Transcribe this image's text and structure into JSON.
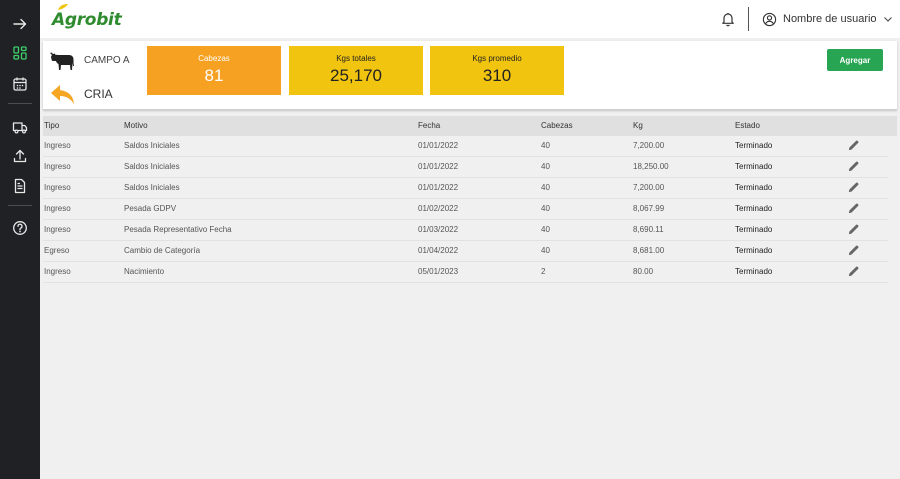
{
  "app": {
    "logo_text": "Agrobit",
    "user_name": "Nombre de usuario",
    "brand_color": "#2e8b2e"
  },
  "sidebar": {
    "items": [
      {
        "icon": "arrow-right-icon"
      },
      {
        "icon": "dashboard-grid-icon",
        "active": true
      },
      {
        "icon": "calendar-icon"
      },
      {
        "icon": "truck-icon"
      },
      {
        "icon": "upload-icon"
      },
      {
        "icon": "document-icon"
      },
      {
        "icon": "help-icon"
      }
    ]
  },
  "summary": {
    "campo": "CAMPO A",
    "categoria": "CRIA",
    "cards": [
      {
        "label": "Cabezas",
        "value": "81",
        "color": "#f7a123"
      },
      {
        "label": "Kgs totales",
        "value": "25,170",
        "color": "#f1c40f"
      },
      {
        "label": "Kgs promedio",
        "value": "310",
        "color": "#f1c40f"
      }
    ],
    "add_label": "Agregar"
  },
  "table": {
    "headers": {
      "tipo": "Tipo",
      "motivo": "Motivo",
      "fecha": "Fecha",
      "cabezas": "Cabezas",
      "kg": "Kg",
      "estado": "Estado"
    },
    "rows": [
      {
        "tipo": "Ingreso",
        "motivo": "Saldos Iniciales",
        "fecha": "01/01/2022",
        "cabezas": "40",
        "kg": "7,200.00",
        "estado": "Terminado"
      },
      {
        "tipo": "Ingreso",
        "motivo": "Saldos Iniciales",
        "fecha": "01/01/2022",
        "cabezas": "40",
        "kg": "18,250.00",
        "estado": "Terminado"
      },
      {
        "tipo": "Ingreso",
        "motivo": "Saldos Iniciales",
        "fecha": "01/01/2022",
        "cabezas": "40",
        "kg": "7,200.00",
        "estado": "Terminado"
      },
      {
        "tipo": "Ingreso",
        "motivo": "Pesada GDPV",
        "fecha": "01/02/2022",
        "cabezas": "40",
        "kg": "8,067.99",
        "estado": "Terminado"
      },
      {
        "tipo": "Ingreso",
        "motivo": "Pesada Representativo Fecha",
        "fecha": "01/03/2022",
        "cabezas": "40",
        "kg": "8,690.11",
        "estado": "Terminado"
      },
      {
        "tipo": "Egreso",
        "motivo": "Cambio de Categoría",
        "fecha": "01/04/2022",
        "cabezas": "40",
        "kg": "8,681.00",
        "estado": "Terminado"
      },
      {
        "tipo": "Ingreso",
        "motivo": "Nacimiento",
        "fecha": "05/01/2023",
        "cabezas": "2",
        "kg": "80.00",
        "estado": "Terminado"
      }
    ]
  }
}
